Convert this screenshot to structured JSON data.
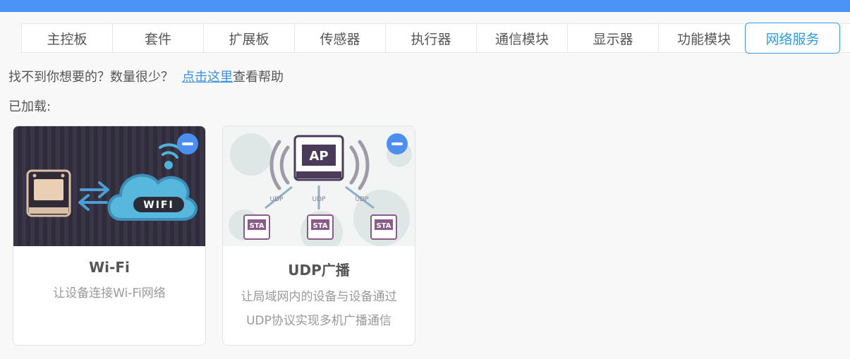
{
  "tabs": [
    {
      "label": "主控板",
      "name": "tab-main-board"
    },
    {
      "label": "套件",
      "name": "tab-kits"
    },
    {
      "label": "扩展板",
      "name": "tab-expansion-board"
    },
    {
      "label": "传感器",
      "name": "tab-sensors"
    },
    {
      "label": "执行器",
      "name": "tab-actuators"
    },
    {
      "label": "通信模块",
      "name": "tab-communication"
    },
    {
      "label": "显示器",
      "name": "tab-displays"
    },
    {
      "label": "功能模块",
      "name": "tab-function-modules"
    },
    {
      "label": "网络服务",
      "name": "tab-network-services"
    }
  ],
  "help": {
    "prefix": "找不到你想要的？数量很少？",
    "link": "点击这里",
    "suffix": "查看帮助"
  },
  "loaded_label": "已加载:",
  "cards": [
    {
      "title": "Wi-Fi",
      "desc": [
        "让设备连接Wi-Fi网络"
      ],
      "image_text": "WIFI",
      "icon": "minus-circle-icon"
    },
    {
      "title": "UDP广播",
      "desc": [
        "让局域网内的设备与设备通过",
        "UDP协议实现多机广播通信"
      ],
      "image_labels": {
        "ap": "AP",
        "sta": "STA",
        "udp": "UDP"
      },
      "icon": "minus-circle-icon"
    }
  ],
  "colors": {
    "topbar": "#4c93f8",
    "active_tab": "#2f9be6",
    "link": "#3a8ee6",
    "remove_button": "#4d8ff0"
  }
}
